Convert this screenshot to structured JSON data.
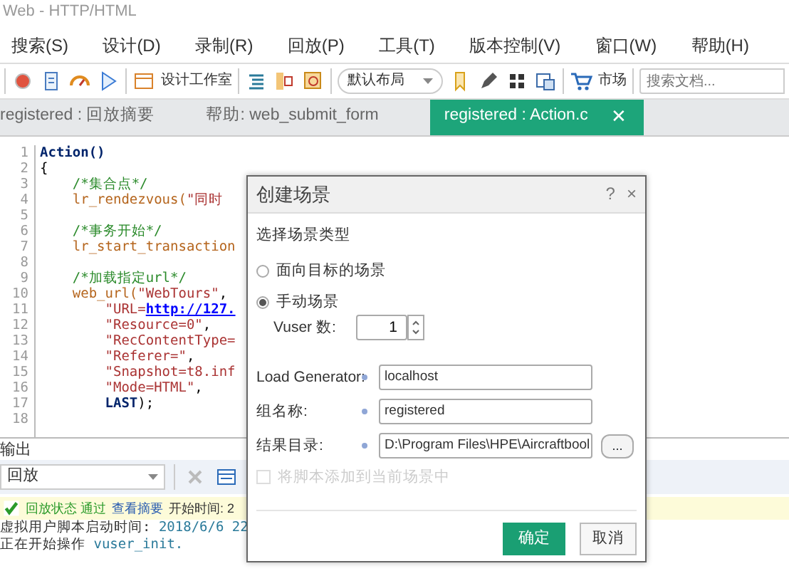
{
  "window": {
    "title": "Web - HTTP/HTML"
  },
  "menu": [
    "搜索(S)",
    "设计(D)",
    "录制(R)",
    "回放(P)",
    "工具(T)",
    "版本控制(V)",
    "窗口(W)",
    "帮助(H)"
  ],
  "toolbar": {
    "design_studio": "设计工作室",
    "layout": "默认布局",
    "market": "市场",
    "search": {
      "placeholder": "搜索文档..."
    }
  },
  "tabs": [
    {
      "label": "registered : 回放摘要",
      "selected": false
    },
    {
      "label": "帮助: web_submit_form",
      "selected": false
    },
    {
      "label": "registered : Action.c",
      "selected": true,
      "close": "✕"
    }
  ],
  "editor": {
    "lines": [
      {
        "number": "1",
        "segments": [
          {
            "kind": "keyword",
            "text": "Action()"
          }
        ]
      },
      {
        "number": "2",
        "segments": [
          {
            "kind": "plain",
            "text": "{"
          }
        ]
      },
      {
        "number": "3",
        "segments": [
          {
            "kind": "comment",
            "text": "    /*集合点*/"
          }
        ]
      },
      {
        "number": "4",
        "segments": [
          {
            "kind": "func",
            "text": "    lr_rendezvous("
          },
          {
            "kind": "string",
            "text": "\"同时"
          }
        ]
      },
      {
        "number": "5"
      },
      {
        "number": "6",
        "segments": [
          {
            "kind": "comment",
            "text": "    /*事务开始*/"
          }
        ]
      },
      {
        "number": "7",
        "segments": [
          {
            "kind": "func",
            "text": "    lr_start_transaction"
          }
        ]
      },
      {
        "number": "8"
      },
      {
        "number": "9",
        "segments": [
          {
            "kind": "comment",
            "text": "    /*加载指定url*/"
          }
        ]
      },
      {
        "number": "10",
        "segments": [
          {
            "kind": "func",
            "text": "    web_url("
          },
          {
            "kind": "string",
            "text": "\"WebTours\""
          },
          {
            "kind": "plain",
            "text": ","
          }
        ]
      },
      {
        "number": "11",
        "segments": [
          {
            "kind": "string",
            "text": "        \"URL="
          },
          {
            "kind": "link",
            "text": "http://127."
          }
        ]
      },
      {
        "number": "12",
        "segments": [
          {
            "kind": "string",
            "text": "        \"Resource=0\""
          },
          {
            "kind": "plain",
            "text": ","
          }
        ]
      },
      {
        "number": "13",
        "segments": [
          {
            "kind": "string",
            "text": "        \"RecContentType="
          }
        ]
      },
      {
        "number": "14",
        "segments": [
          {
            "kind": "string",
            "text": "        \"Referer=\""
          },
          {
            "kind": "plain",
            "text": ","
          }
        ]
      },
      {
        "number": "15",
        "segments": [
          {
            "kind": "string",
            "text": "        \"Snapshot=t8.inf"
          }
        ]
      },
      {
        "number": "16",
        "segments": [
          {
            "kind": "string",
            "text": "        \"Mode=HTML\""
          },
          {
            "kind": "plain",
            "text": ","
          }
        ]
      },
      {
        "number": "17",
        "segments": [
          {
            "kind": "keyword",
            "text": "        LAST"
          },
          {
            "kind": "plain",
            "text": ");"
          }
        ]
      },
      {
        "number": "18"
      }
    ]
  },
  "output": {
    "title": "输出",
    "filter": "回放",
    "status_label": "回放状态 通过",
    "summary_link": "查看摘要",
    "start_time": "开始时间: 2",
    "log": [
      {
        "label": "虚拟用户脚本启动时间: ",
        "value": "2018/6/6 22"
      },
      {
        "label": "正在开始操作 ",
        "value": "vuser_init."
      }
    ]
  },
  "dialog": {
    "title": "创建场景",
    "help": "?",
    "close": "×",
    "section": "选择场景类型",
    "options": [
      {
        "label": "面向目标的场景",
        "selected": false
      },
      {
        "label": "手动场景",
        "selected": true
      }
    ],
    "vuser_label": "Vuser 数:",
    "vuser_value": "1",
    "fields": [
      {
        "label": "Load Generator:",
        "value": "localhost",
        "browse": false
      },
      {
        "label": "组名称:",
        "value": "registered",
        "browse": false
      },
      {
        "label": "结果目录:",
        "value": "D:\\Program Files\\HPE\\Aircraftbool",
        "browse": true,
        "browse_label": "..."
      }
    ],
    "add_to_scenario": {
      "label": "将脚本添加到当前场景中",
      "checked": false,
      "disabled": true
    },
    "buttons": [
      {
        "label": "确定",
        "kind": "primary"
      },
      {
        "label": "取消",
        "kind": "secondary"
      }
    ]
  }
}
